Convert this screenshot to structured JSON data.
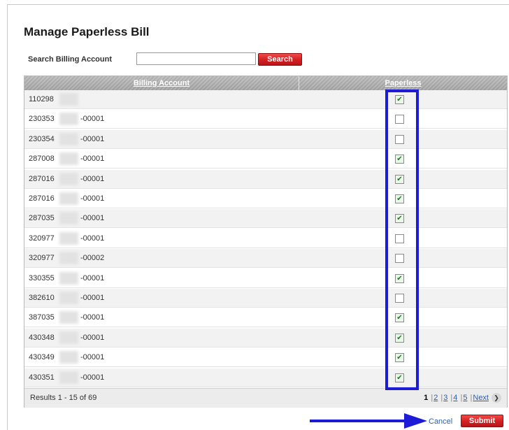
{
  "page": {
    "title": "Manage Paperless Bill"
  },
  "search": {
    "label": "Search Billing Account",
    "value": "",
    "placeholder": "",
    "button_label": "Search"
  },
  "table": {
    "headers": {
      "account": "Billing Account",
      "paperless": "Paperless"
    },
    "rows": [
      {
        "prefix": "110298",
        "suffix": "",
        "paperless": true
      },
      {
        "prefix": "230353",
        "suffix": "-00001",
        "paperless": false
      },
      {
        "prefix": "230354",
        "suffix": "-00001",
        "paperless": false
      },
      {
        "prefix": "287008",
        "suffix": "-00001",
        "paperless": true
      },
      {
        "prefix": "287016",
        "suffix": "-00001",
        "paperless": true
      },
      {
        "prefix": "287016",
        "suffix": "-00001",
        "paperless": true
      },
      {
        "prefix": "287035",
        "suffix": "-00001",
        "paperless": true
      },
      {
        "prefix": "320977",
        "suffix": "-00001",
        "paperless": false
      },
      {
        "prefix": "320977",
        "suffix": "-00002",
        "paperless": false
      },
      {
        "prefix": "330355",
        "suffix": "-00001",
        "paperless": true
      },
      {
        "prefix": "382610",
        "suffix": "-00001",
        "paperless": false
      },
      {
        "prefix": "387035",
        "suffix": "-00001",
        "paperless": true
      },
      {
        "prefix": "430348",
        "suffix": "-00001",
        "paperless": true
      },
      {
        "prefix": "430349",
        "suffix": "-00001",
        "paperless": true
      },
      {
        "prefix": "430351",
        "suffix": "-00001",
        "paperless": true
      }
    ],
    "results_text": "Results 1 - 15 of 69",
    "pager": {
      "current": "1",
      "pages": [
        "2",
        "3",
        "4",
        "5"
      ],
      "next_label": "Next"
    }
  },
  "actions": {
    "cancel_label": "Cancel",
    "submit_label": "Submit"
  },
  "colors": {
    "accent_red": "#d21f22",
    "annotation_blue": "#1c1cd6",
    "link_blue": "#2b5fb4"
  }
}
